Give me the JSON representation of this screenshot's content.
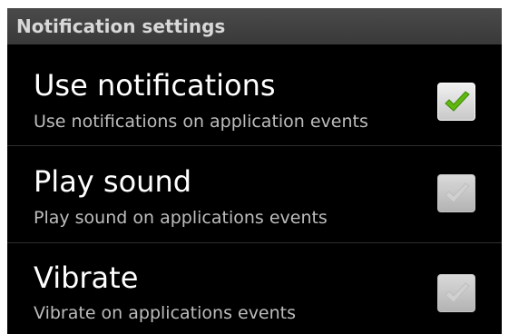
{
  "header": {
    "title": "Notification settings"
  },
  "preferences": [
    {
      "title": "Use notifications",
      "summary": "Use notifications on application events",
      "checked": true
    },
    {
      "title": "Play sound",
      "summary": "Play sound on applications events",
      "checked": false
    },
    {
      "title": "Vibrate",
      "summary": "Vibrate on applications events",
      "checked": false
    }
  ],
  "colors": {
    "check_mark_on": "#5fb80f",
    "check_mark_off": "#d9d9d9",
    "background": "#000000",
    "header_bg": "#444444"
  }
}
